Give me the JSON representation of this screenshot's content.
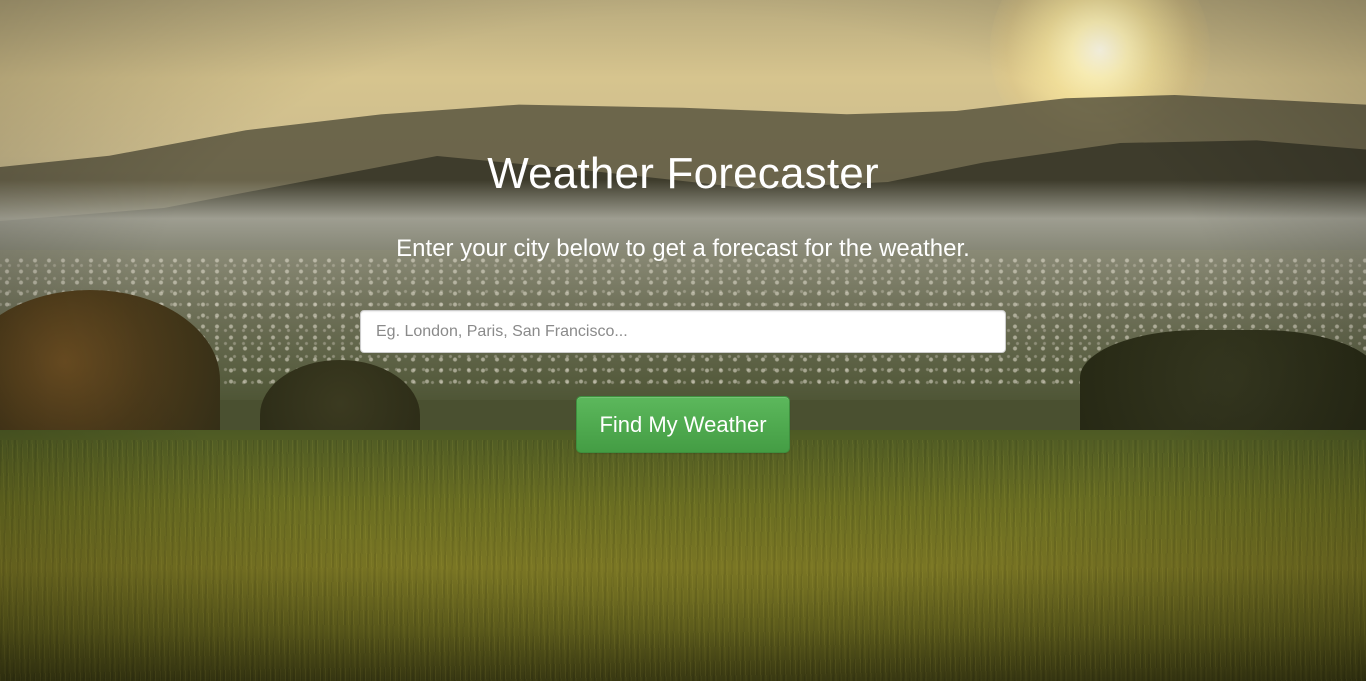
{
  "page": {
    "title": "Weather Forecaster",
    "subtitle": "Enter your city below to get a forecast for the weather."
  },
  "search": {
    "value": "",
    "placeholder": "Eg. London, Paris, San Francisco..."
  },
  "actions": {
    "find_label": "Find My Weather"
  },
  "colors": {
    "button_green": "#5cb85c",
    "text_white": "#ffffff"
  }
}
